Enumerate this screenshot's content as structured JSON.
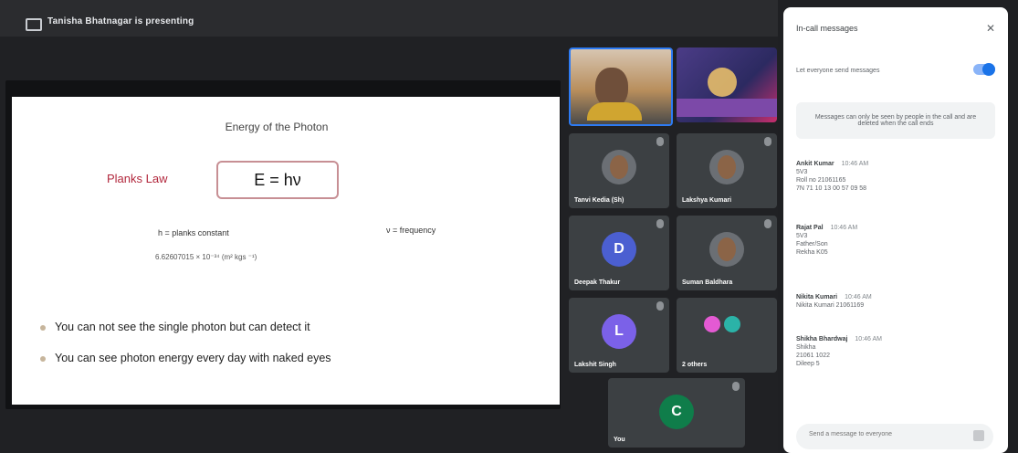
{
  "presenter": {
    "label": "Tanisha Bhatnagar is presenting"
  },
  "slide": {
    "title": "Energy of the Photon",
    "law_label": "Planks Law",
    "formula": "E = hν",
    "h_definition": "h = planks constant",
    "h_value": "6.62607015 × 10⁻³⁴ (m² kgs ⁻¹)",
    "nu_definition": "ν = frequency",
    "bullets": [
      "You can not see the single photon but can detect it",
      "You can see photon energy every day with naked eyes"
    ]
  },
  "participants": [
    {
      "name": "",
      "type": "camera"
    },
    {
      "name": "",
      "type": "promo"
    },
    {
      "name": "Tanvi Kedia (Sh)",
      "type": "avatar"
    },
    {
      "name": "Lakshya Kumari",
      "type": "avatar"
    },
    {
      "name": "Deepak Thakur",
      "type": "initial",
      "initial": "D",
      "color": "#4b5fd1"
    },
    {
      "name": "Suman Baldhara",
      "type": "avatar"
    },
    {
      "name": "Lakshit Singh",
      "type": "initial",
      "initial": "L",
      "color": "#7b61e8"
    },
    {
      "name": "2 others",
      "type": "multi"
    },
    {
      "name": "You",
      "type": "initial",
      "initial": "C",
      "color": "#0f7d4a"
    }
  ],
  "chat": {
    "title": "In-call messages",
    "toggle_label": "Let everyone send messages",
    "notice": "Messages can only be seen by people in the call and are deleted when the call ends",
    "messages": [
      {
        "sender": "Ankit Kumar",
        "time": "10:46 AM",
        "lines": [
          "5V3",
          "Roll no 21061165",
          "7N 71 10 13 00 57 09 58"
        ]
      },
      {
        "sender": "Rajat Pal",
        "time": "10:46 AM",
        "lines": [
          "5V3",
          "Father/Son",
          "Rekha K05"
        ]
      },
      {
        "sender": "Nikita Kumari",
        "time": "10:46 AM",
        "lines": [
          "Nikita Kumari 21061169"
        ]
      },
      {
        "sender": "Shikha Bhardwaj",
        "time": "10:46 AM",
        "lines": [
          "Shikha",
          "21061 1022",
          "Dileep 5"
        ]
      }
    ],
    "input_placeholder": "Send a message to everyone"
  }
}
